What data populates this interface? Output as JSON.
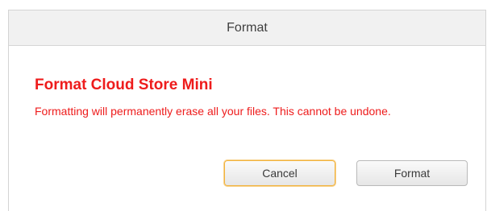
{
  "dialog": {
    "title": "Format",
    "heading": "Format Cloud Store Mini",
    "message": "Formatting will permanently erase all your files. This cannot be undone.",
    "cancel_label": "Cancel",
    "format_label": "Format"
  },
  "colors": {
    "warning_text": "#ee1c1c",
    "focus_ring": "#f2b33d",
    "titlebar_bg": "#f1f1f1"
  }
}
